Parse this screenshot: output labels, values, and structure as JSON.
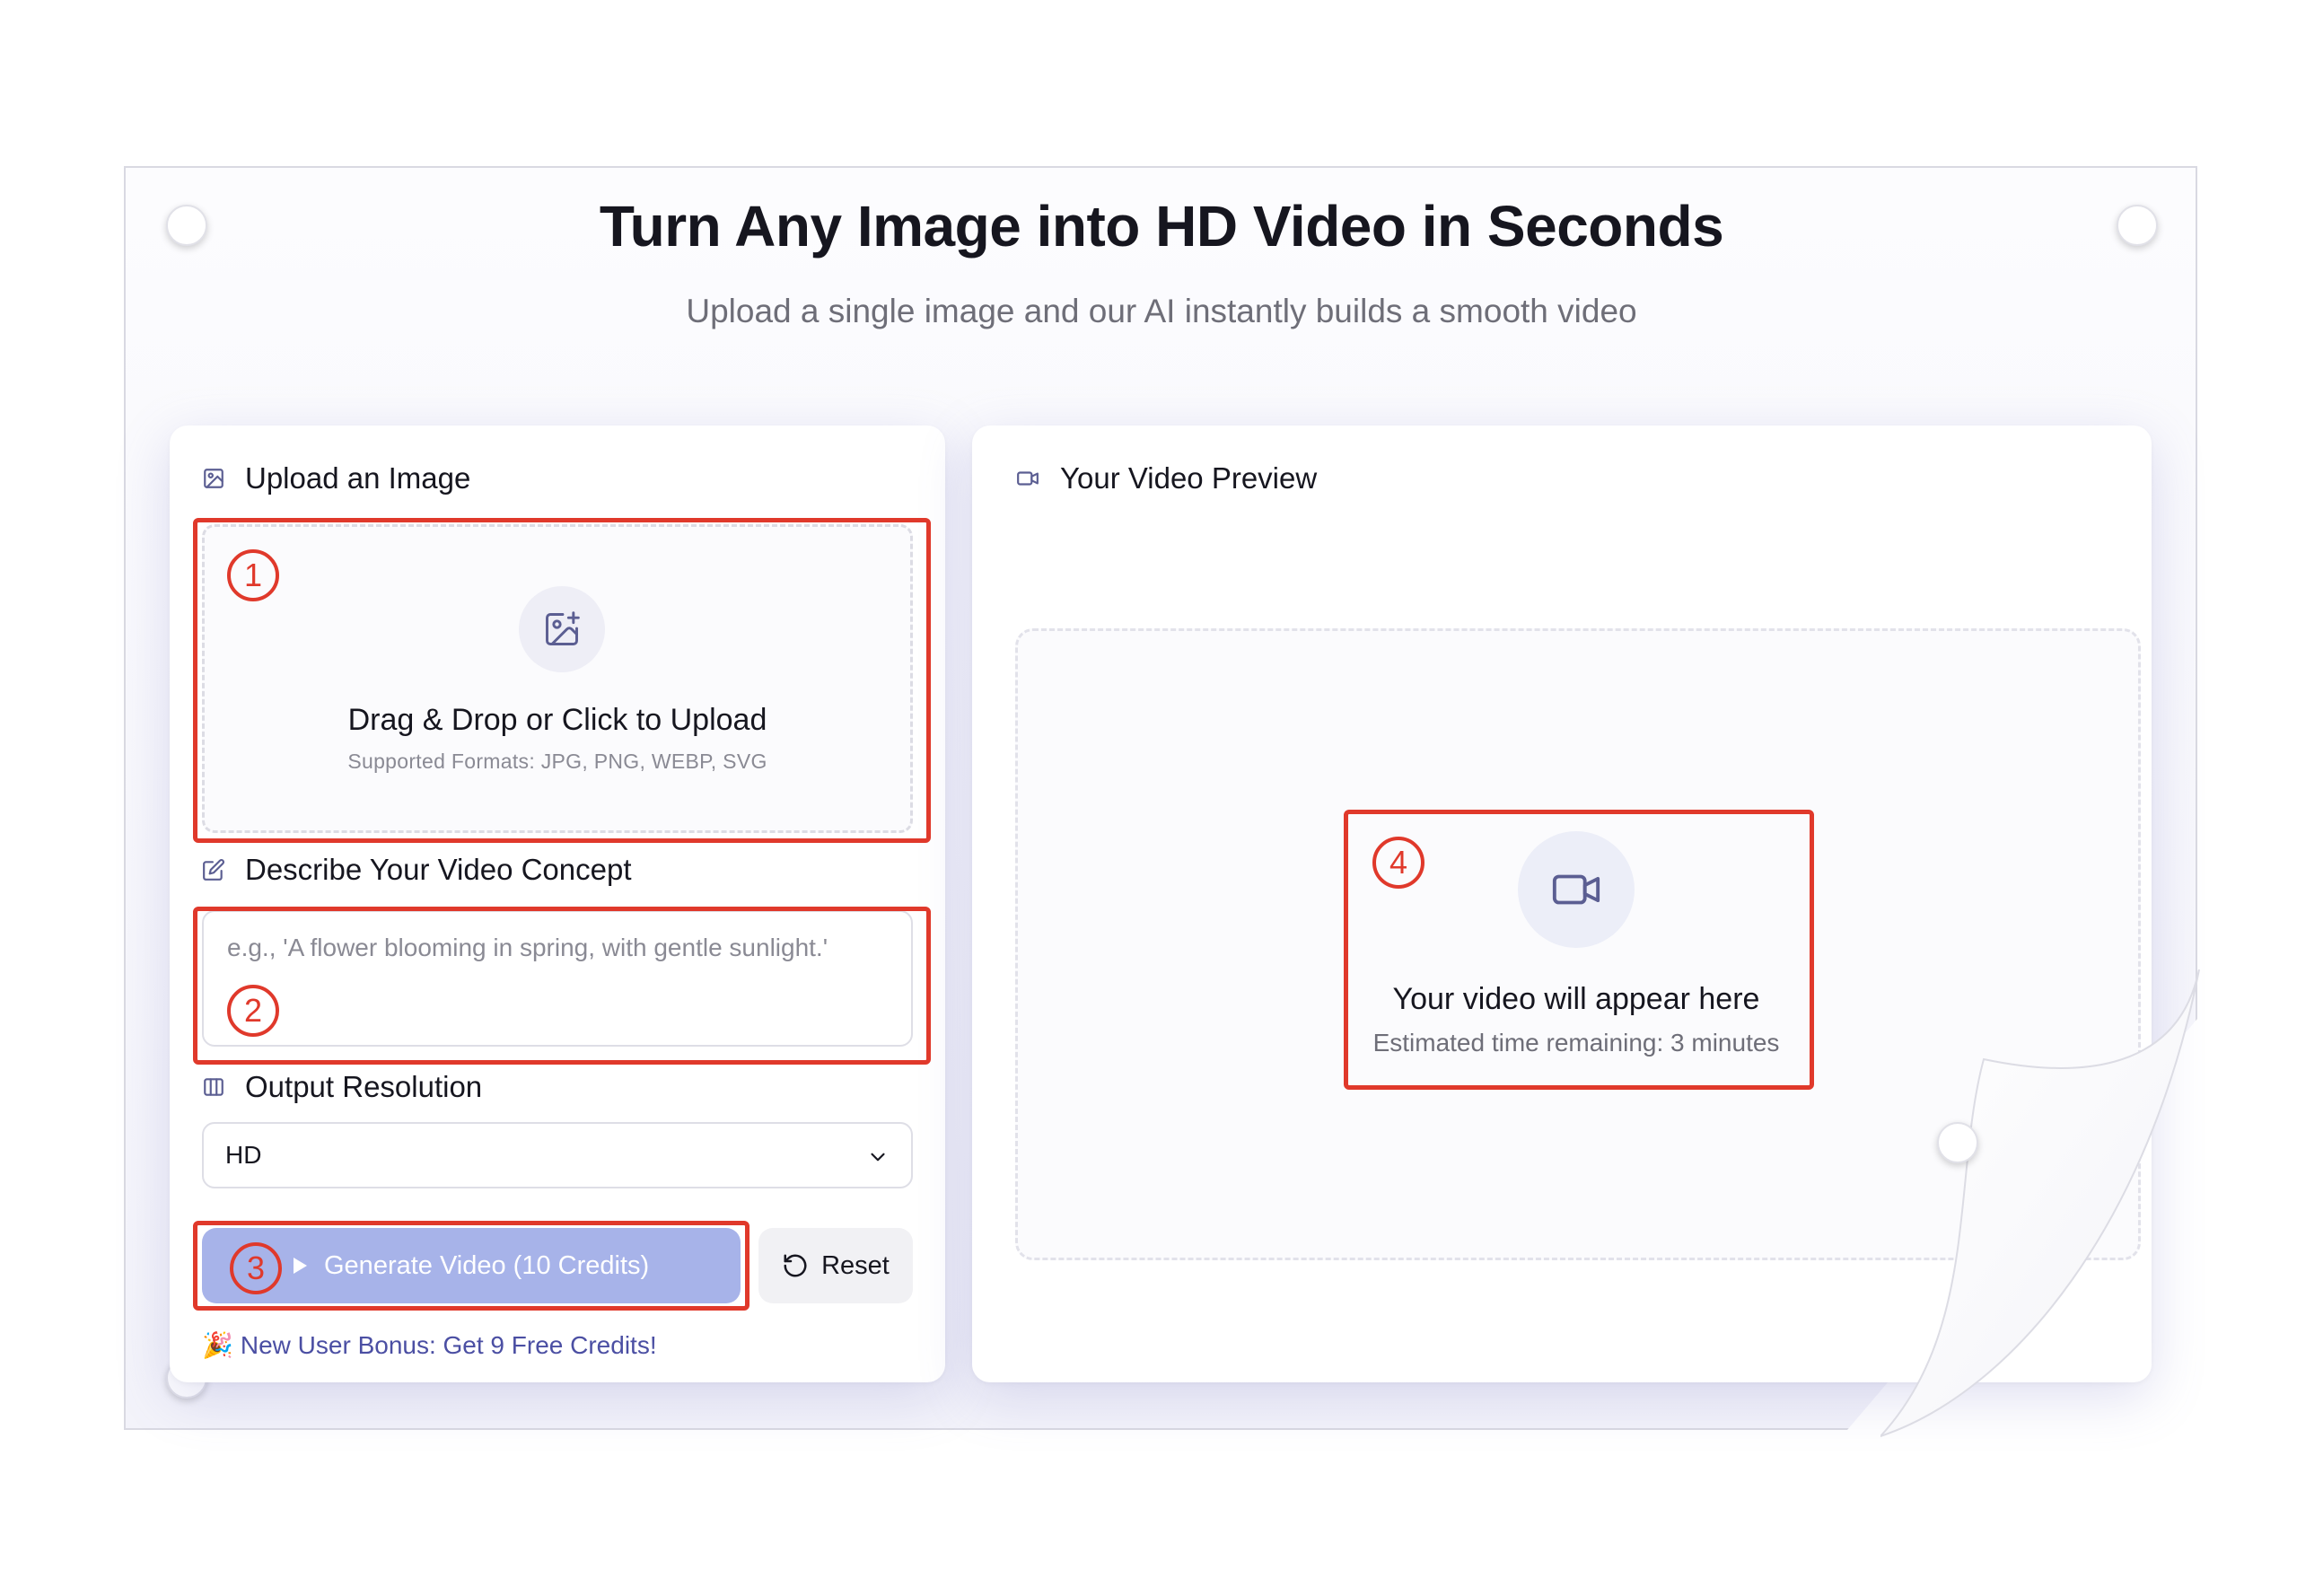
{
  "hero": {
    "title": "Turn Any Image into HD Video in Seconds",
    "subtitle": "Upload a single image and our AI instantly builds a smooth video"
  },
  "upload": {
    "heading": "Upload an Image",
    "drop_title": "Drag & Drop or Click to Upload",
    "formats": "Supported Formats: JPG, PNG, WEBP, SVG"
  },
  "concept": {
    "heading": "Describe Your Video Concept",
    "placeholder": "e.g., 'A flower blooming in spring, with gentle sunlight.'"
  },
  "resolution": {
    "heading": "Output Resolution",
    "selected": "HD"
  },
  "actions": {
    "generate_label": "Generate Video (10 Credits)",
    "reset_label": "Reset"
  },
  "bonus": {
    "emoji": "🎉",
    "text": "New User Bonus: Get 9 Free Credits!"
  },
  "preview": {
    "heading": "Your Video Preview",
    "placeholder_title": "Your video will appear here",
    "eta": "Estimated time remaining: 3 minutes"
  },
  "annotations": [
    "1",
    "2",
    "3",
    "4"
  ],
  "colors": {
    "accent": "#a7b3e9",
    "link": "#4b4fa3",
    "annotation": "#e0392b"
  },
  "icons": {
    "upload_heading": "image-icon",
    "drop": "image-plus-icon",
    "concept_heading": "edit-icon",
    "resolution_heading": "columns-icon",
    "select": "chevron-down-icon",
    "generate": "play-icon",
    "reset": "rotate-ccw-icon",
    "preview_heading": "video-camera-icon",
    "preview_placeholder": "video-camera-icon"
  }
}
